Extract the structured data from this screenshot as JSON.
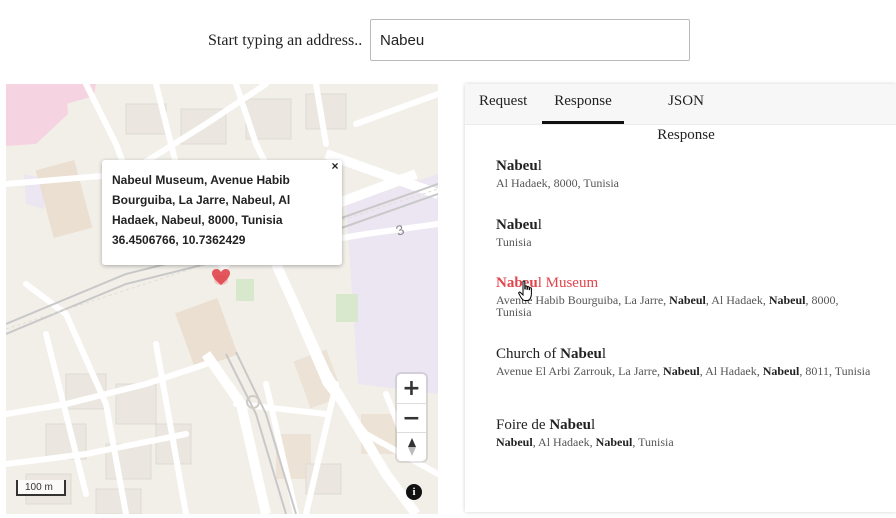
{
  "search": {
    "label": "Start typing an address..",
    "value": "Nabeu"
  },
  "map": {
    "popup": {
      "address": "Nabeul Museum, Avenue Habib Bourguiba, La Jarre, Nabeul, Al Hadaek, Nabeul, 8000, Tunisia",
      "coords": "36.4506766, 10.7362429",
      "close_label": "×"
    },
    "zoom_in_label": "+",
    "zoom_out_label": "−",
    "scale_label": "100 m",
    "info_label": "i",
    "road_label": "3",
    "marker_color": "#e0454c"
  },
  "tabs": [
    {
      "label": "Request",
      "active": false
    },
    {
      "label": "Response",
      "active": true
    },
    {
      "label": "JSON Response",
      "active": false
    }
  ],
  "results": [
    {
      "title_bold": "Nabeu",
      "title_rest": "l",
      "sub": "Al Hadaek, 8000, Tunisia"
    },
    {
      "title_bold": "Nabeu",
      "title_rest": "l",
      "sub": "Tunisia"
    },
    {
      "title_bold": "Nabeu",
      "title_rest": "l Museum",
      "sub_parts": [
        "Avenue Habib Bourguiba, La Jarre, ",
        "Nabeul",
        ", Al Hadaek, ",
        "Nabeul",
        ", 8000, Tunisia"
      ],
      "hover": true
    },
    {
      "title_prefix": "Church of ",
      "title_bold": "Nabeu",
      "title_rest": "l",
      "sub_parts": [
        "Avenue El Arbi Zarrouk, La Jarre, ",
        "Nabeul",
        ", Al Hadaek, ",
        "Nabeul",
        ", 8011, Tunisia"
      ]
    },
    {
      "title_prefix": "Foire de ",
      "title_bold": "Nabeu",
      "title_rest": "l",
      "sub_parts": [
        "Nabeul",
        ", Al Hadaek, ",
        "Nabeul",
        ", Tunisia"
      ]
    }
  ],
  "colors": {
    "accent_hover": "#e0454c",
    "map_background": "#f2efe9"
  }
}
